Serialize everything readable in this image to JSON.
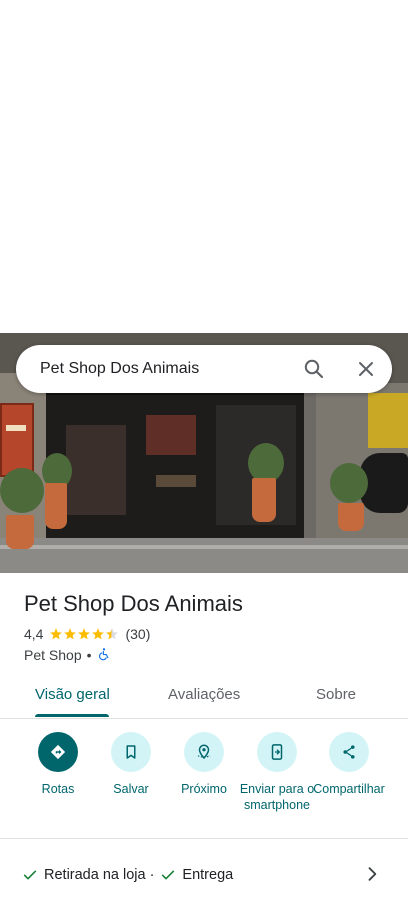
{
  "search": {
    "query": "Pet Shop Dos Animais"
  },
  "place": {
    "name": "Pet Shop Dos Animais",
    "rating": "4,4",
    "stars": 4.4,
    "review_count": "(30)",
    "category": "Pet Shop",
    "separator": "•"
  },
  "tabs": [
    "Visão geral",
    "Avaliações",
    "Sobre"
  ],
  "actions": [
    {
      "label": "Rotas",
      "icon": "directions-icon"
    },
    {
      "label": "Salvar",
      "icon": "bookmark-icon"
    },
    {
      "label": "Próximo",
      "icon": "nearby-icon"
    },
    {
      "label": "Enviar para o smartphone",
      "icon": "send-to-phone-icon"
    },
    {
      "label": "Compartilhar",
      "icon": "share-icon"
    }
  ],
  "services": {
    "pickup": "Retirada na loja",
    "sep": "·",
    "delivery": "Entrega"
  },
  "colors": {
    "accent": "#00666c",
    "accent_light": "#d3f4f7",
    "star": "#fbbc04",
    "check": "#188038"
  }
}
